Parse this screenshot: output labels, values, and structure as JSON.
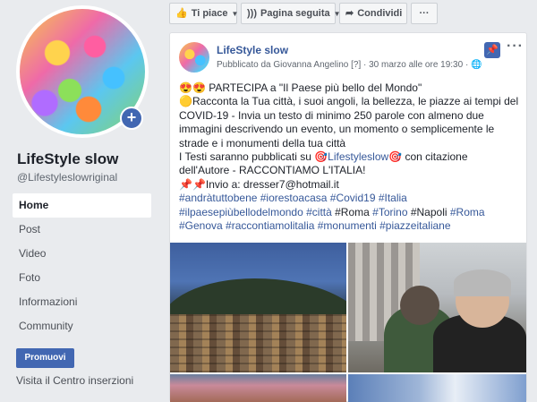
{
  "left": {
    "page_name": "LifeStyle slow",
    "page_handle": "@Lifestyleslowriginal",
    "nav_items": [
      "Home",
      "Post",
      "Video",
      "Foto",
      "Informazioni",
      "Community"
    ],
    "promote_label": "Promuovi",
    "ads_link": "Visita il Centro inserzioni"
  },
  "action_bar": {
    "like": "Ti piace",
    "follow": "Pagina seguita",
    "share": "Condividi",
    "more": "···"
  },
  "post": {
    "author": "LifeStyle slow",
    "meta": "Pubblicato da Giovanna Angelino [?] · 30 marzo alle ore 19:30 · ",
    "more": "···",
    "text": {
      "l1_emoji": "😍😍",
      "l1": " PARTECIPA a \"Il Paese più bello del Mondo\"",
      "l2": "🟡Racconta la Tua città, i suoi angoli, la bellezza, le piazze ai tempi del",
      "l3": "COVID-19 - Invia un testo di minimo 250 parole con almeno due",
      "l4": "immagini descrivendo un evento, un momento o semplicemente le",
      "l5": "strade e i monumenti della tua città",
      "l6a": "I Testi saranno pubblicati su 🎯",
      "l6b": "Lifestyleslow",
      "l6c": "🎯 con citazione",
      "l7": "dell'Autore - RACCONTIAMO L'ITALIA!",
      "l8a": "📌📌Invio a: ",
      "l8b": "dresser7@hotmail.it",
      "l9": "#andràtuttobene #iorestoacasa #Covid19 #Italia",
      "l10a": "#ilpaesepiùbellodelmondo #città ",
      "l10b": "#Roma",
      "l10c": " #Torino ",
      "l10d": "#Napoli",
      "l10e": " #Roma",
      "l11": "#Genova #raccontiamolitalia #monumenti #piazzeitaliane"
    }
  }
}
